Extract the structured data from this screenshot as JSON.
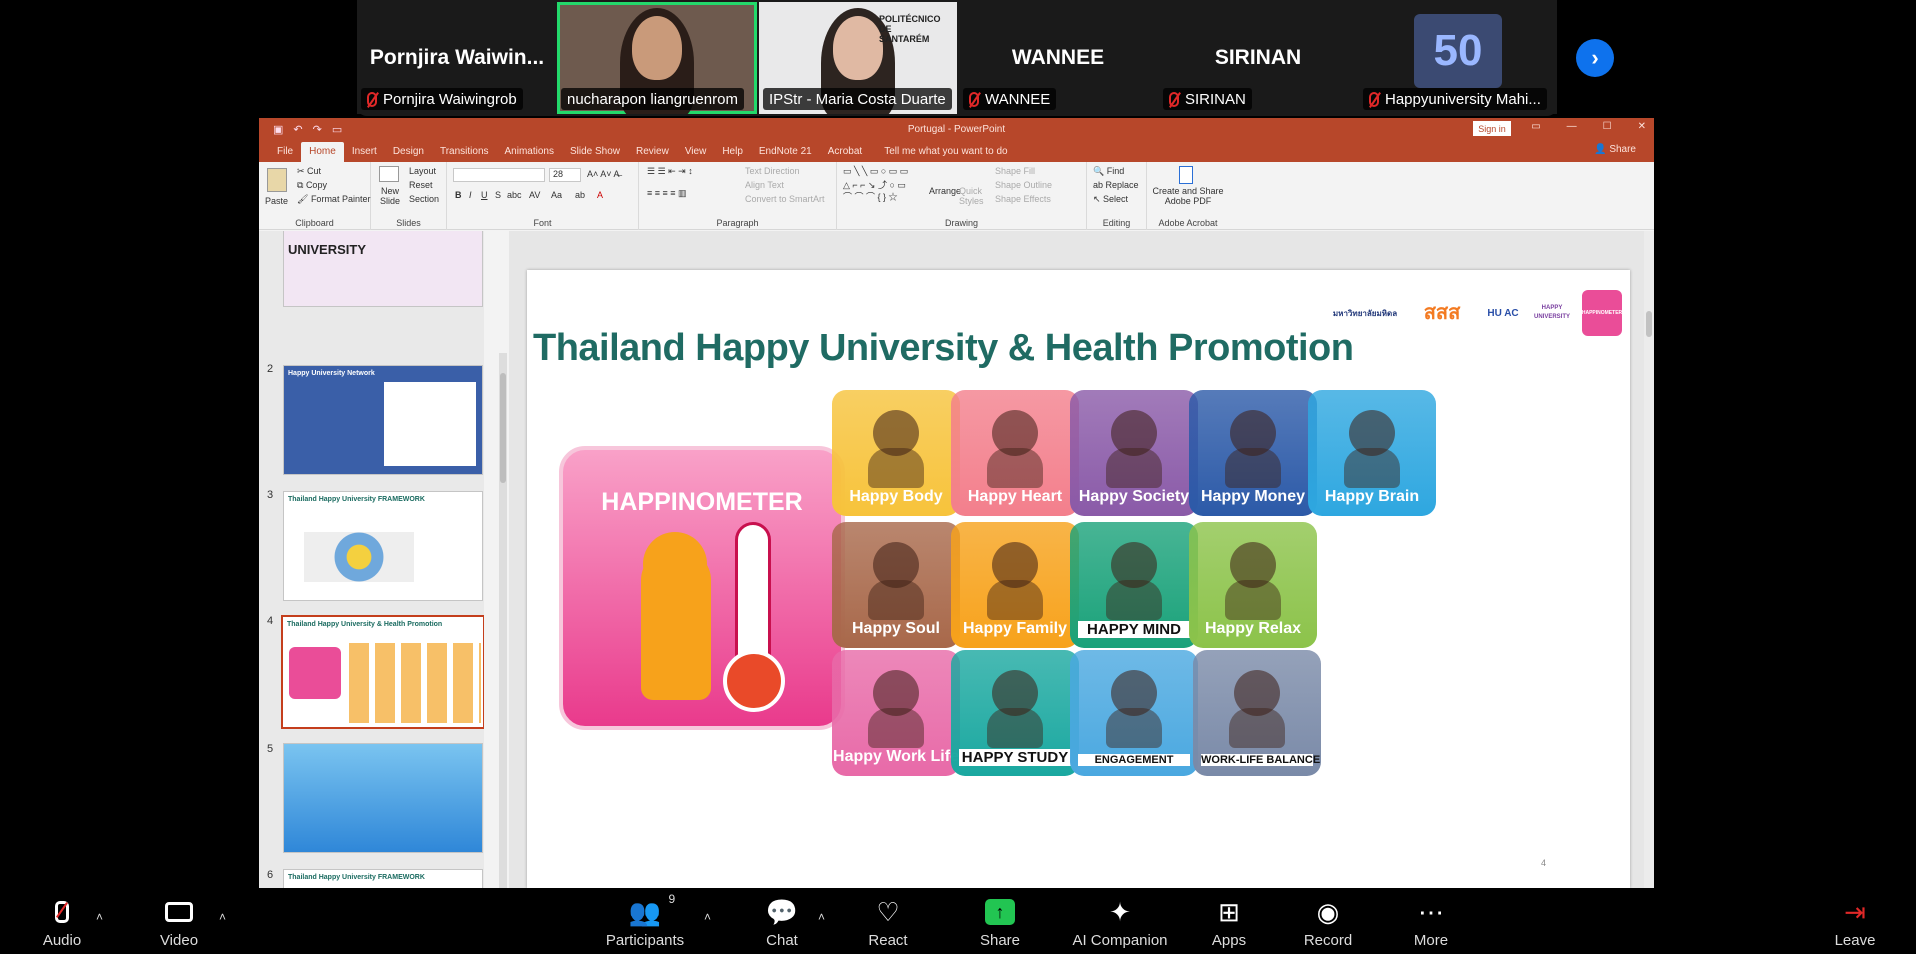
{
  "participants": {
    "tiles": [
      {
        "big_name": "Pornjira  Waiwin...",
        "label": "Pornjira Waiwingrob",
        "muted": true
      },
      {
        "label": "nucharapon liangruenrom",
        "muted": false,
        "active": true
      },
      {
        "label": "IPStr - Maria Costa Duarte",
        "muted": false,
        "logo": "POLITÉCNICO DE SANTARÉM"
      },
      {
        "big_name": "WANNEE",
        "label": "WANNEE",
        "muted": true
      },
      {
        "big_name": "SIRINAN",
        "label": "SIRINAN",
        "muted": true
      },
      {
        "label": "Happyuniversity Mahi...",
        "muted": true,
        "logo_text": "50"
      }
    ],
    "next_icon": "chevron-right-icon"
  },
  "ppt": {
    "title": "Portugal  -  PowerPoint",
    "sign_in": "Sign in",
    "share": "Share",
    "tabs": [
      "File",
      "Home",
      "Insert",
      "Design",
      "Transitions",
      "Animations",
      "Slide Show",
      "Review",
      "View",
      "Help",
      "EndNote 21",
      "Acrobat"
    ],
    "active_tab": "Home",
    "tell_me": "Tell me what you want to do",
    "ribbon": {
      "clipboard": {
        "paste": "Paste",
        "cut": "Cut",
        "copy": "Copy",
        "format_painter": "Format Painter",
        "name": "Clipboard"
      },
      "slides": {
        "new_slide": "New Slide",
        "layout": "Layout",
        "reset": "Reset",
        "section": "Section",
        "name": "Slides"
      },
      "font": {
        "size": "28",
        "name": "Font"
      },
      "paragraph": {
        "text_direction": "Text Direction",
        "align_text": "Align Text",
        "convert": "Convert to SmartArt",
        "name": "Paragraph"
      },
      "drawing": {
        "arrange": "Arrange",
        "quick_styles": "Quick Styles",
        "shape_fill": "Shape Fill",
        "shape_outline": "Shape Outline",
        "shape_effects": "Shape Effects",
        "name": "Drawing"
      },
      "editing": {
        "find": "Find",
        "replace": "Replace",
        "select": "Select",
        "name": "Editing"
      },
      "acrobat": {
        "create": "Create and Share Adobe PDF",
        "name": "Adobe Acrobat"
      }
    },
    "thumbnails": [
      {
        "num": "",
        "title": "UNIVERSITY"
      },
      {
        "num": "2",
        "title": "Happy University Network"
      },
      {
        "num": "3",
        "title": "Thailand Happy University FRAMEWORK"
      },
      {
        "num": "4",
        "title": "Thailand Happy University & Health Promotion",
        "selected": true
      },
      {
        "num": "5",
        "title": ""
      },
      {
        "num": "6",
        "title": "Thailand Happy University FRAMEWORK"
      }
    ],
    "slide": {
      "title": "Thailand Happy University & Health Promotion",
      "happinometer": "HAPPINOMETER",
      "logos": [
        "มหาวิทยาลัยมหิดล",
        "สสส",
        "HU AC",
        "HAPPY UNIVERSITY",
        "HAPPINOMETER"
      ],
      "cards": [
        {
          "label": "Happy Body",
          "color": "#f7c33b"
        },
        {
          "label": "Happy Heart",
          "color": "#f37f8c"
        },
        {
          "label": "Happy Society",
          "color": "#8a5aa8"
        },
        {
          "label": "Happy Money",
          "color": "#2c5aa8"
        },
        {
          "label": "Happy Brain",
          "color": "#2ea7e0"
        },
        {
          "label": "Happy Soul",
          "color": "#a8684a"
        },
        {
          "label": "Happy Family",
          "color": "#f7a21b"
        },
        {
          "label": "HAPPY MIND",
          "color": "#1aa27a"
        },
        {
          "label": "Happy Relax",
          "color": "#8cc34a"
        },
        {
          "label": "Happy Work Life",
          "color": "#e86aa8"
        },
        {
          "label": "HAPPY STUDY",
          "color": "#1aa8a0"
        },
        {
          "label": "ENGAGEMENT",
          "color": "#4aa8e0"
        },
        {
          "label": "WORK-LIFE BALANCE",
          "color": "#7a8aa8"
        }
      ],
      "page_number": "4"
    }
  },
  "toolbar": {
    "audio": "Audio",
    "video": "Video",
    "participants": "Participants",
    "participants_count": "9",
    "chat": "Chat",
    "react": "React",
    "share": "Share",
    "ai_companion": "AI Companion",
    "apps": "Apps",
    "record": "Record",
    "more": "More",
    "leave": "Leave"
  }
}
